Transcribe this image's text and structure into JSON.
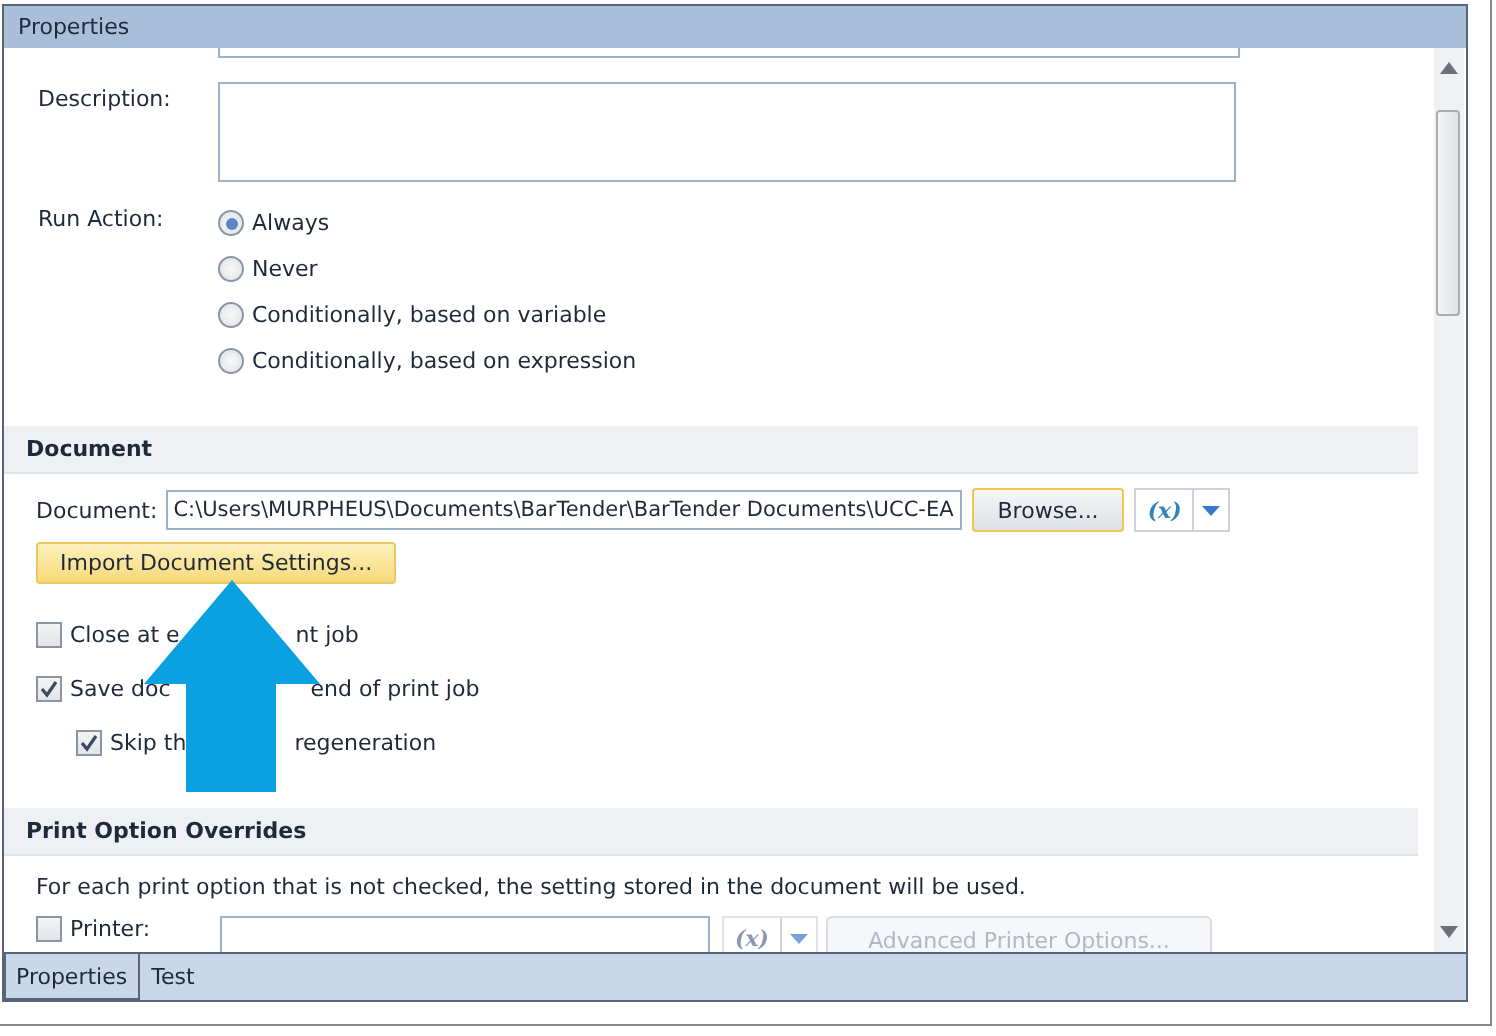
{
  "panel": {
    "title": "Properties"
  },
  "general": {
    "description_label": "Description:",
    "run_action_label": "Run Action:",
    "run_options": [
      {
        "label": "Always",
        "selected": true
      },
      {
        "label": "Never",
        "selected": false
      },
      {
        "label": "Conditionally, based on variable",
        "selected": false
      },
      {
        "label": "Conditionally, based on expression",
        "selected": false
      }
    ]
  },
  "document": {
    "heading": "Document",
    "document_label": "Document:",
    "path": "C:\\Users\\MURPHEUS\\Documents\\BarTender\\BarTender Documents\\UCC-EA",
    "browse_button": "Browse...",
    "variable_button": "(x)",
    "import_button": "Import Document Settings...",
    "options": [
      {
        "label_parts": [
          "Close at e",
          "nt job"
        ],
        "checked": false
      },
      {
        "label_parts": [
          "Save doc",
          "end of print job"
        ],
        "checked": true,
        "children": [
          {
            "label_parts": [
              "Skip th",
              "regeneration"
            ],
            "checked": true
          }
        ]
      }
    ]
  },
  "print_overrides": {
    "heading": "Print Option Overrides",
    "note": "For each print option that is not checked, the setting stored in the document will be used.",
    "rows": [
      {
        "label": "Printer:",
        "checked": false,
        "variable_button": "(x)",
        "action_button": "Advanced Printer Options...",
        "disabled": true
      }
    ]
  },
  "tabs": [
    {
      "label": "Properties",
      "selected": true
    },
    {
      "label": "Test",
      "selected": false
    }
  ]
}
